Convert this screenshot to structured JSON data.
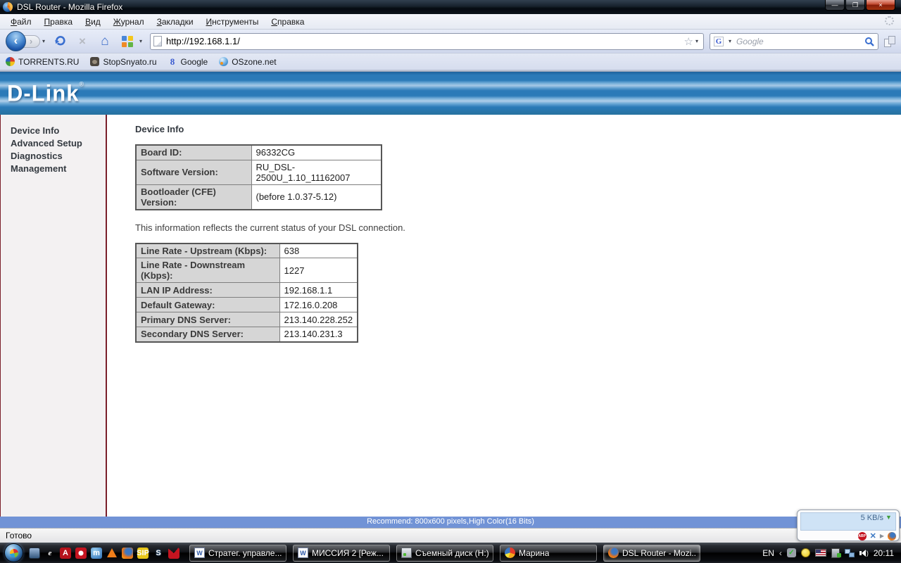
{
  "window": {
    "title": "DSL Router - Mozilla Firefox"
  },
  "menu": {
    "items": [
      "Файл",
      "Правка",
      "Вид",
      "Журнал",
      "Закладки",
      "Инструменты",
      "Справка"
    ]
  },
  "navbar": {
    "url": "http://192.168.1.1/",
    "search_placeholder": "Google"
  },
  "bookmarks": {
    "items": [
      "TORRENTS.RU",
      "StopSnyato.ru",
      "Google",
      "OSzone.net"
    ]
  },
  "banner": {
    "logo": "D-Link",
    "reg": "®"
  },
  "sidebar": {
    "items": [
      "Device Info",
      "Advanced Setup",
      "Diagnostics",
      "Management"
    ]
  },
  "main": {
    "heading": "Device Info",
    "device_table": {
      "rows": [
        {
          "label": "Board ID:",
          "value": "96332CG"
        },
        {
          "label": "Software Version:",
          "value": "RU_DSL-2500U_1.10_11162007"
        },
        {
          "label": "Bootloader (CFE) Version:",
          "value": "(before 1.0.37-5.12)"
        }
      ]
    },
    "note": "This information reflects the current status of your DSL connection.",
    "status_table": {
      "rows": [
        {
          "label": "Line Rate - Upstream (Kbps):",
          "value": "638"
        },
        {
          "label": "Line Rate - Downstream (Kbps):",
          "value": "1227"
        },
        {
          "label": "LAN IP Address:",
          "value": "192.168.1.1"
        },
        {
          "label": "Default Gateway:",
          "value": "172.16.0.208"
        },
        {
          "label": "Primary DNS Server:",
          "value": "213.140.228.252"
        },
        {
          "label": "Secondary DNS Server:",
          "value": "213.140.231.3"
        }
      ]
    }
  },
  "recommend_bar": {
    "text": "Recommend: 800x600 pixels,High Color(16 Bits)"
  },
  "status_bar": {
    "text": "Готово"
  },
  "taskbar": {
    "tasks": [
      {
        "label": "Стратег. управле..."
      },
      {
        "label": "МИССИЯ 2 [Реж..."
      },
      {
        "label": "Съемный диск (H:)"
      },
      {
        "label": "Марина"
      },
      {
        "label": "DSL Router - Mozi..."
      }
    ],
    "tray": {
      "lang": "EN",
      "time": "20:11"
    }
  },
  "widget": {
    "speed": "5 KB/s",
    "abp": "ABP"
  },
  "colors": {
    "banner_blue": "#2b7ab8",
    "maroon": "#7a1f2b",
    "recommend_blue": "#7193d6"
  }
}
